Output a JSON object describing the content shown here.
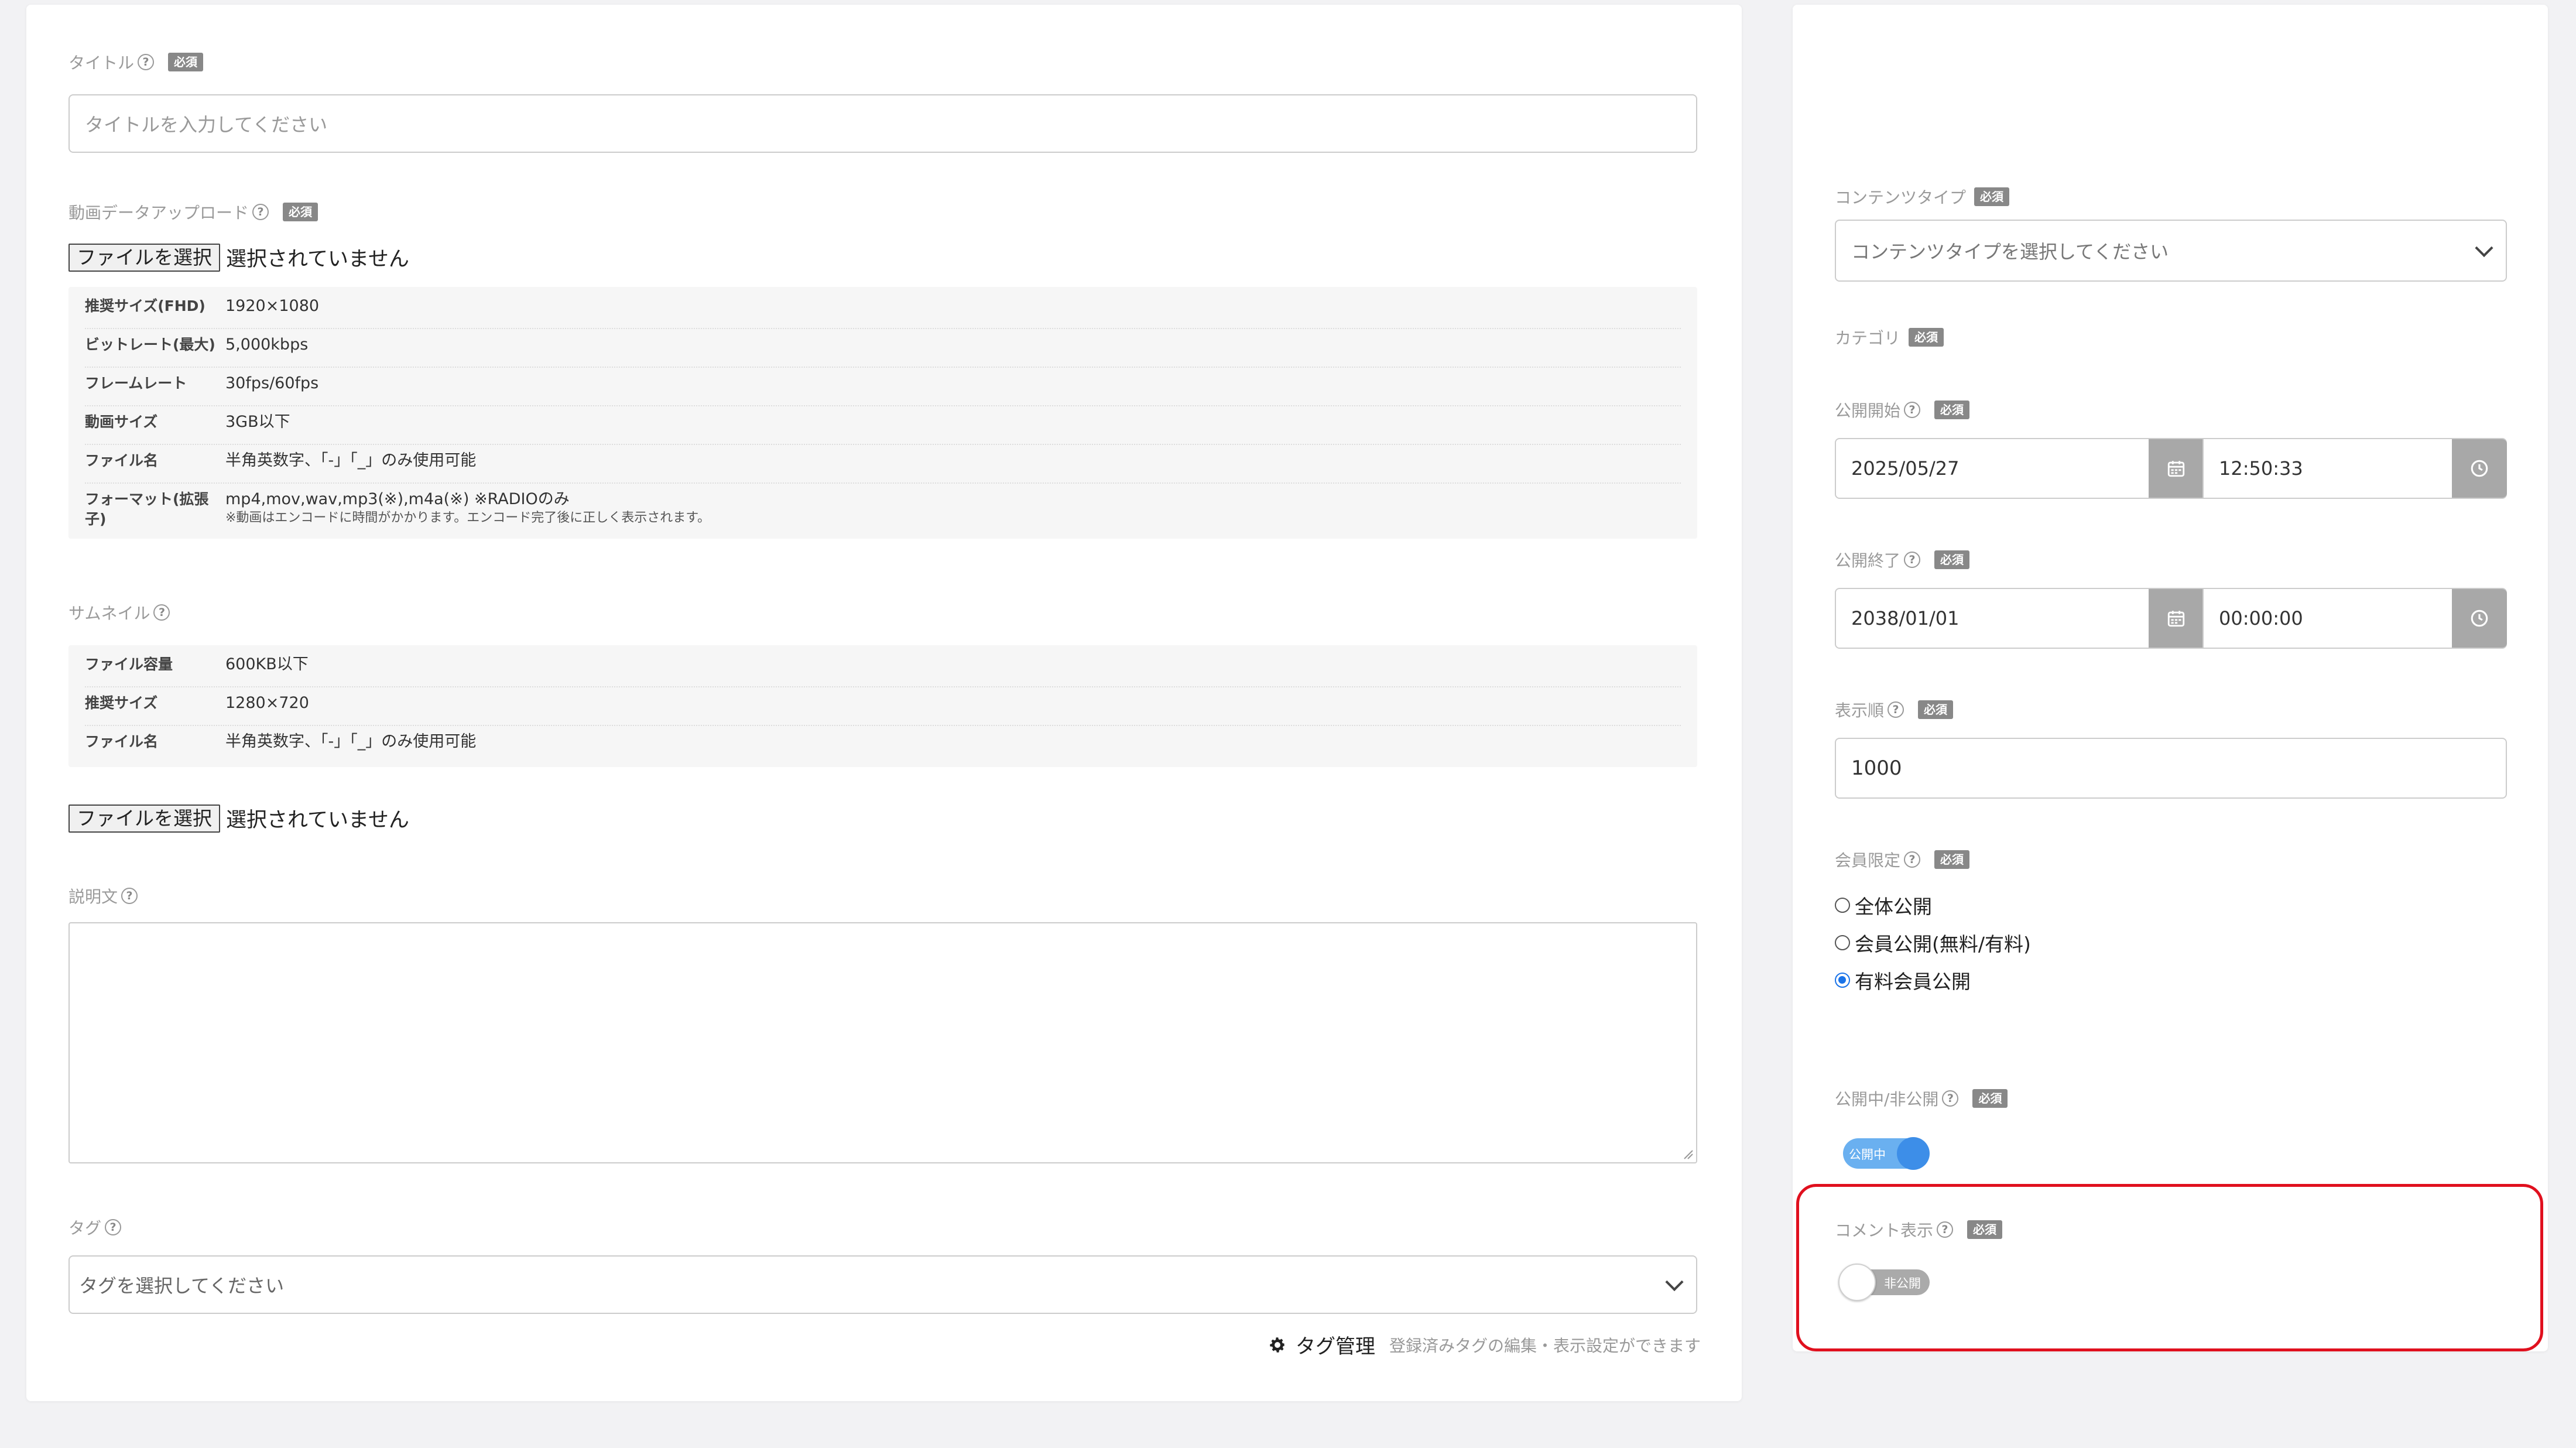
{
  "help_glyph": "?",
  "required_badge": "必須",
  "title": {
    "label": "タイトル",
    "placeholder": "タイトルを入力してください"
  },
  "video_upload": {
    "label": "動画データアップロード",
    "file_button": "ファイルを選択",
    "file_status": "選択されていません",
    "specs": [
      {
        "key": "推奨サイズ(FHD)",
        "value": "1920×1080"
      },
      {
        "key": "ビットレート(最大)",
        "value": "5,000kbps"
      },
      {
        "key": "フレームレート",
        "value": "30fps/60fps"
      },
      {
        "key": "動画サイズ",
        "value": "3GB以下"
      },
      {
        "key": "ファイル名",
        "value": "半角英数字、「-」「_」のみ使用可能"
      },
      {
        "key": "フォーマット(拡張子)",
        "value": "mp4,mov,wav,mp3(※),m4a(※) ※RADIOのみ",
        "note": "※動画はエンコードに時間がかかります。エンコード完了後に正しく表示されます。"
      }
    ]
  },
  "thumbnail": {
    "label": "サムネイル",
    "specs": [
      {
        "key": "ファイル容量",
        "value": "600KB以下"
      },
      {
        "key": "推奨サイズ",
        "value": "1280×720"
      },
      {
        "key": "ファイル名",
        "value": "半角英数字、「-」「_」のみ使用可能"
      }
    ],
    "file_button": "ファイルを選択",
    "file_status": "選択されていません"
  },
  "description": {
    "label": "説明文"
  },
  "tags": {
    "label": "タグ",
    "placeholder": "タグを選択してください",
    "manage_label": "タグ管理",
    "manage_hint": "登録済みタグの編集・表示設定ができます"
  },
  "content_type": {
    "label": "コンテンツタイプ",
    "placeholder": "コンテンツタイプを選択してください"
  },
  "category": {
    "label": "カテゴリ"
  },
  "publish_start": {
    "label": "公開開始",
    "date": "2025/05/27",
    "time": "12:50:33"
  },
  "publish_end": {
    "label": "公開終了",
    "date": "2038/01/01",
    "time": "00:00:00"
  },
  "display_order": {
    "label": "表示順",
    "value": "1000"
  },
  "membership": {
    "label": "会員限定",
    "options": [
      "全体公開",
      "会員公開(無料/有料)",
      "有料会員公開"
    ],
    "selected": "有料会員公開"
  },
  "publish_status": {
    "label": "公開中/非公開",
    "toggle_text": "公開中",
    "on": true
  },
  "comment_display": {
    "label": "コメント表示",
    "toggle_text": "非公開",
    "on": false
  },
  "colors": {
    "highlight": "#e0101e",
    "toggle_on": "#3d8ee8",
    "radio_selected": "#1a73e8"
  }
}
